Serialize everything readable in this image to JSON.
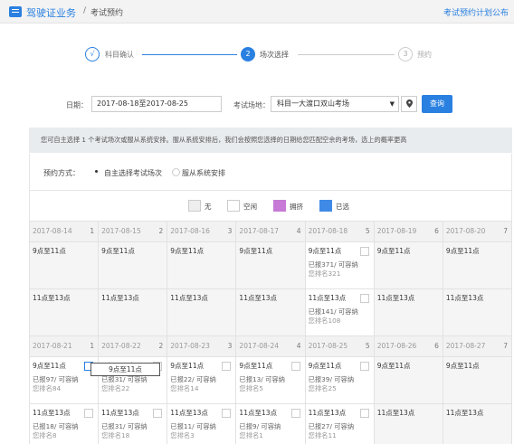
{
  "header": {
    "brand": "驾驶证业务",
    "separator": "/",
    "breadcrumb": "考试预约",
    "right_link": "考试预约计划公布"
  },
  "steps": [
    {
      "num": "√",
      "label": "科目确认",
      "state": "done"
    },
    {
      "num": "2",
      "label": "场次选择",
      "state": "active"
    },
    {
      "num": "3",
      "label": "预约",
      "state": "todo"
    }
  ],
  "filter": {
    "date_label": "日期：",
    "date_value": "2017-08-18至2017-08-25",
    "site_label": "考试场地：",
    "site_value": "科目一大渡口双山考场",
    "query_button": "查询"
  },
  "notice": "您可自主选择 1 个考试场次或服从系统安排。服从系统安排后，我们会按照您选择的日期给您匹配空余的考场，选上的概率更高",
  "booking_mode": {
    "label": "预约方式：",
    "options": [
      {
        "label": "自主选择考试场次",
        "selected": true
      },
      {
        "label": "服从系统安排",
        "selected": false
      }
    ]
  },
  "legend": [
    {
      "label": "无",
      "color": "#eeeeee"
    },
    {
      "label": "空闲",
      "color": "#ffffff"
    },
    {
      "label": "拥挤",
      "color": "#c77ad6"
    },
    {
      "label": "已选",
      "color": "#3f8ae6"
    }
  ],
  "weeks": [
    {
      "days": [
        {
          "date": "2017-08-14",
          "num": "1"
        },
        {
          "date": "2017-08-15",
          "num": "2"
        },
        {
          "date": "2017-08-16",
          "num": "3"
        },
        {
          "date": "2017-08-17",
          "num": "4"
        },
        {
          "date": "2017-08-18",
          "num": "5"
        },
        {
          "date": "2017-08-19",
          "num": "6"
        },
        {
          "date": "2017-08-20",
          "num": "7"
        }
      ],
      "slots": [
        [
          {
            "time": "9点至11点",
            "disabled": true
          },
          {
            "time": "9点至11点",
            "disabled": true
          },
          {
            "time": "9点至11点",
            "disabled": true
          },
          {
            "time": "9点至11点",
            "disabled": true
          },
          {
            "time": "9点至11点",
            "disabled": false,
            "stat": "已报371/ 可容纳",
            "rank": "您排名321"
          },
          {
            "time": "9点至11点",
            "disabled": true
          },
          {
            "time": "9点至11点",
            "disabled": true
          }
        ],
        [
          {
            "time": "11点至13点",
            "disabled": true
          },
          {
            "time": "11点至13点",
            "disabled": true
          },
          {
            "time": "11点至13点",
            "disabled": true
          },
          {
            "time": "11点至13点",
            "disabled": true
          },
          {
            "time": "11点至13点",
            "disabled": false,
            "stat": "已报141/ 可容纳",
            "rank": "您排名108"
          },
          {
            "time": "11点至13点",
            "disabled": true
          },
          {
            "time": "11点至13点",
            "disabled": true
          }
        ]
      ]
    },
    {
      "days": [
        {
          "date": "2017-08-21",
          "num": "1"
        },
        {
          "date": "2017-08-22",
          "num": "2"
        },
        {
          "date": "2017-08-23",
          "num": "3"
        },
        {
          "date": "2017-08-24",
          "num": "4"
        },
        {
          "date": "2017-08-25",
          "num": "5"
        },
        {
          "date": "2017-08-26",
          "num": "6"
        },
        {
          "date": "2017-08-27",
          "num": "7"
        }
      ],
      "slots": [
        [
          {
            "time": "9点至11点",
            "disabled": false,
            "stat": "已报97/ 可容纳",
            "rank": "您排名84",
            "hover": true
          },
          {
            "time": "9点至11点",
            "disabled": false,
            "stat": "已报31/ 可容纳",
            "rank": "您排名22"
          },
          {
            "time": "9点至11点",
            "disabled": false,
            "stat": "已报22/ 可容纳",
            "rank": "您排名14"
          },
          {
            "time": "9点至11点",
            "disabled": false,
            "stat": "已报13/ 可容纳",
            "rank": "您排名5"
          },
          {
            "time": "9点至11点",
            "disabled": false,
            "stat": "已报39/ 可容纳",
            "rank": "您排名25"
          },
          {
            "time": "9点至11点",
            "disabled": true
          },
          {
            "time": "9点至11点",
            "disabled": true
          }
        ],
        [
          {
            "time": "11点至13点",
            "disabled": false,
            "stat": "已报18/ 可容纳",
            "rank": "您排名8"
          },
          {
            "time": "11点至13点",
            "disabled": false,
            "stat": "已报31/ 可容纳",
            "rank": "您排名18"
          },
          {
            "time": "11点至13点",
            "disabled": false,
            "stat": "已报11/ 可容纳",
            "rank": "您排名3"
          },
          {
            "time": "11点至13点",
            "disabled": false,
            "stat": "已报9/ 可容纳",
            "rank": "您排名1"
          },
          {
            "time": "11点至13点",
            "disabled": false,
            "stat": "已报27/ 可容纳",
            "rank": "您排名11"
          },
          {
            "time": "11点至13点",
            "disabled": true
          },
          {
            "time": "11点至13点",
            "disabled": true
          }
        ]
      ]
    }
  ],
  "tooltip": "9点至11点"
}
